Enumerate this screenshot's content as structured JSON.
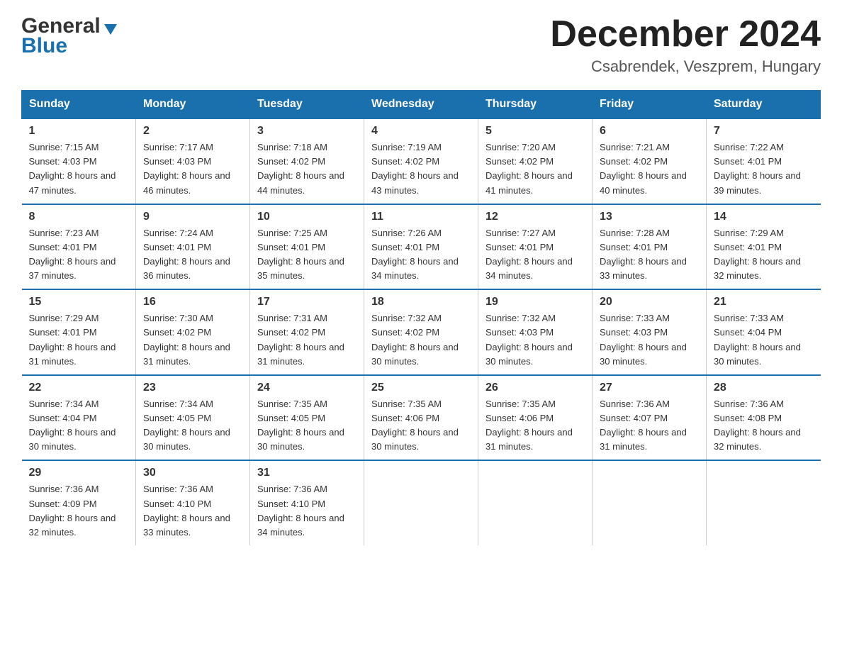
{
  "logo": {
    "general": "General",
    "blue": "Blue"
  },
  "title": {
    "month": "December 2024",
    "location": "Csabrendek, Veszprem, Hungary"
  },
  "headers": [
    "Sunday",
    "Monday",
    "Tuesday",
    "Wednesday",
    "Thursday",
    "Friday",
    "Saturday"
  ],
  "weeks": [
    [
      {
        "day": "1",
        "sunrise": "7:15 AM",
        "sunset": "4:03 PM",
        "daylight": "8 hours and 47 minutes."
      },
      {
        "day": "2",
        "sunrise": "7:17 AM",
        "sunset": "4:03 PM",
        "daylight": "8 hours and 46 minutes."
      },
      {
        "day": "3",
        "sunrise": "7:18 AM",
        "sunset": "4:02 PM",
        "daylight": "8 hours and 44 minutes."
      },
      {
        "day": "4",
        "sunrise": "7:19 AM",
        "sunset": "4:02 PM",
        "daylight": "8 hours and 43 minutes."
      },
      {
        "day": "5",
        "sunrise": "7:20 AM",
        "sunset": "4:02 PM",
        "daylight": "8 hours and 41 minutes."
      },
      {
        "day": "6",
        "sunrise": "7:21 AM",
        "sunset": "4:02 PM",
        "daylight": "8 hours and 40 minutes."
      },
      {
        "day": "7",
        "sunrise": "7:22 AM",
        "sunset": "4:01 PM",
        "daylight": "8 hours and 39 minutes."
      }
    ],
    [
      {
        "day": "8",
        "sunrise": "7:23 AM",
        "sunset": "4:01 PM",
        "daylight": "8 hours and 37 minutes."
      },
      {
        "day": "9",
        "sunrise": "7:24 AM",
        "sunset": "4:01 PM",
        "daylight": "8 hours and 36 minutes."
      },
      {
        "day": "10",
        "sunrise": "7:25 AM",
        "sunset": "4:01 PM",
        "daylight": "8 hours and 35 minutes."
      },
      {
        "day": "11",
        "sunrise": "7:26 AM",
        "sunset": "4:01 PM",
        "daylight": "8 hours and 34 minutes."
      },
      {
        "day": "12",
        "sunrise": "7:27 AM",
        "sunset": "4:01 PM",
        "daylight": "8 hours and 34 minutes."
      },
      {
        "day": "13",
        "sunrise": "7:28 AM",
        "sunset": "4:01 PM",
        "daylight": "8 hours and 33 minutes."
      },
      {
        "day": "14",
        "sunrise": "7:29 AM",
        "sunset": "4:01 PM",
        "daylight": "8 hours and 32 minutes."
      }
    ],
    [
      {
        "day": "15",
        "sunrise": "7:29 AM",
        "sunset": "4:01 PM",
        "daylight": "8 hours and 31 minutes."
      },
      {
        "day": "16",
        "sunrise": "7:30 AM",
        "sunset": "4:02 PM",
        "daylight": "8 hours and 31 minutes."
      },
      {
        "day": "17",
        "sunrise": "7:31 AM",
        "sunset": "4:02 PM",
        "daylight": "8 hours and 31 minutes."
      },
      {
        "day": "18",
        "sunrise": "7:32 AM",
        "sunset": "4:02 PM",
        "daylight": "8 hours and 30 minutes."
      },
      {
        "day": "19",
        "sunrise": "7:32 AM",
        "sunset": "4:03 PM",
        "daylight": "8 hours and 30 minutes."
      },
      {
        "day": "20",
        "sunrise": "7:33 AM",
        "sunset": "4:03 PM",
        "daylight": "8 hours and 30 minutes."
      },
      {
        "day": "21",
        "sunrise": "7:33 AM",
        "sunset": "4:04 PM",
        "daylight": "8 hours and 30 minutes."
      }
    ],
    [
      {
        "day": "22",
        "sunrise": "7:34 AM",
        "sunset": "4:04 PM",
        "daylight": "8 hours and 30 minutes."
      },
      {
        "day": "23",
        "sunrise": "7:34 AM",
        "sunset": "4:05 PM",
        "daylight": "8 hours and 30 minutes."
      },
      {
        "day": "24",
        "sunrise": "7:35 AM",
        "sunset": "4:05 PM",
        "daylight": "8 hours and 30 minutes."
      },
      {
        "day": "25",
        "sunrise": "7:35 AM",
        "sunset": "4:06 PM",
        "daylight": "8 hours and 30 minutes."
      },
      {
        "day": "26",
        "sunrise": "7:35 AM",
        "sunset": "4:06 PM",
        "daylight": "8 hours and 31 minutes."
      },
      {
        "day": "27",
        "sunrise": "7:36 AM",
        "sunset": "4:07 PM",
        "daylight": "8 hours and 31 minutes."
      },
      {
        "day": "28",
        "sunrise": "7:36 AM",
        "sunset": "4:08 PM",
        "daylight": "8 hours and 32 minutes."
      }
    ],
    [
      {
        "day": "29",
        "sunrise": "7:36 AM",
        "sunset": "4:09 PM",
        "daylight": "8 hours and 32 minutes."
      },
      {
        "day": "30",
        "sunrise": "7:36 AM",
        "sunset": "4:10 PM",
        "daylight": "8 hours and 33 minutes."
      },
      {
        "day": "31",
        "sunrise": "7:36 AM",
        "sunset": "4:10 PM",
        "daylight": "8 hours and 34 minutes."
      },
      null,
      null,
      null,
      null
    ]
  ]
}
